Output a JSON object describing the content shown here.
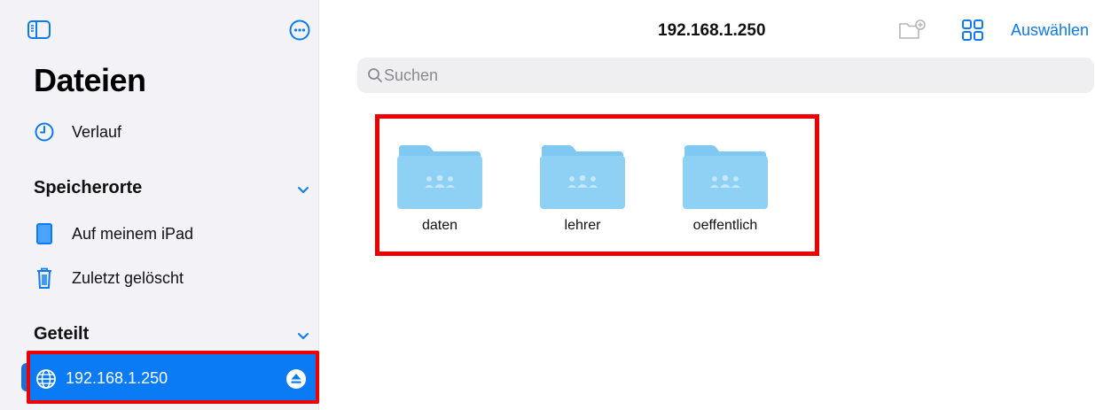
{
  "sidebar": {
    "title": "Dateien",
    "recents_label": "Verlauf",
    "locations_section": "Speicherorte",
    "locations": [
      {
        "label": "Auf meinem iPad",
        "icon": "ipad-icon"
      },
      {
        "label": "Zuletzt gelöscht",
        "icon": "trash-icon"
      }
    ],
    "shared_section": "Geteilt",
    "shared_server": {
      "label": "192.168.1.250",
      "icon": "globe-icon"
    }
  },
  "toolbar": {
    "title": "192.168.1.250",
    "select_label": "Auswählen"
  },
  "search": {
    "placeholder": "Suchen"
  },
  "folders": [
    {
      "name": "daten",
      "icon": "shared-folder-icon"
    },
    {
      "name": "lehrer",
      "icon": "shared-folder-icon"
    },
    {
      "name": "oeffentlich",
      "icon": "shared-folder-icon"
    }
  ],
  "colors": {
    "accent": "#0a7bf5",
    "highlight_border": "#ee0000",
    "sidebar_bg": "#f2f2f7",
    "folder_blue": "#7ec8f2"
  }
}
